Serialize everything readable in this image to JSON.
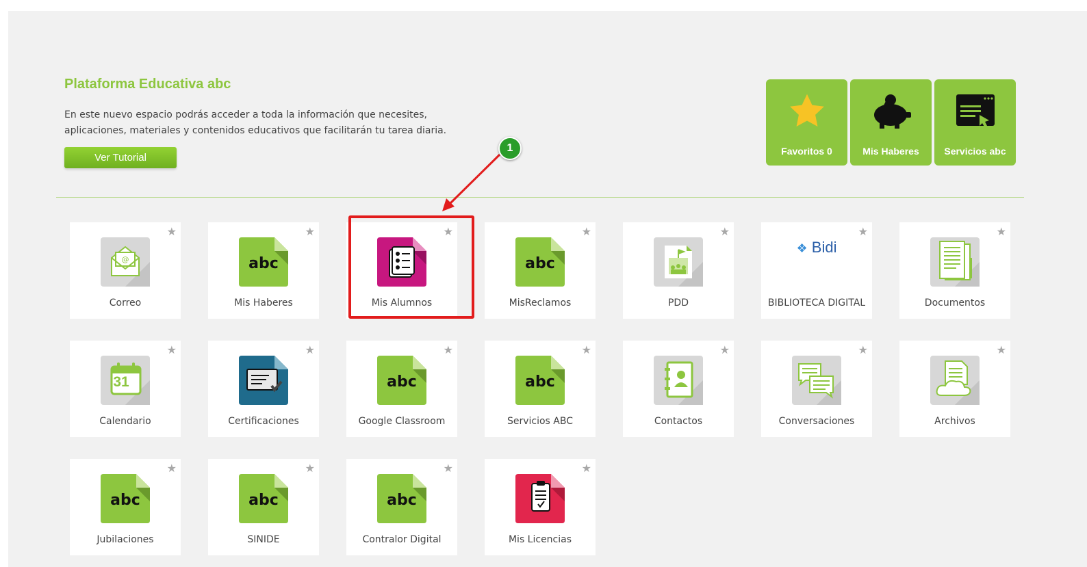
{
  "header": {
    "title": "Plataforma Educativa abc",
    "description_line1": "En este nuevo espacio podrás acceder a toda la información que necesites,",
    "description_line2": "aplicaciones, materiales y contenidos educativos que facilitarán tu tarea diaria.",
    "tutorial_button": "Ver Tutorial"
  },
  "quick_links": [
    {
      "label": "Favoritos 0",
      "icon": "star-icon"
    },
    {
      "label": "Mis Haberes",
      "icon": "piggy-bank-icon"
    },
    {
      "label": "Servicios abc",
      "icon": "services-window-icon"
    }
  ],
  "apps": [
    {
      "label": "Correo",
      "icon": "mail-icon"
    },
    {
      "label": "Mis Haberes",
      "icon": "abc-doc-icon"
    },
    {
      "label": "Mis Alumnos",
      "icon": "students-list-icon"
    },
    {
      "label": "MisReclamos",
      "icon": "abc-doc-icon"
    },
    {
      "label": "PDD",
      "icon": "school-photo-icon"
    },
    {
      "label": "BIBLIOTECA DIGITAL",
      "icon": "bidi-logo-icon",
      "logo_text": "Bidi"
    },
    {
      "label": "Documentos",
      "icon": "documents-icon"
    },
    {
      "label": "Calendario",
      "icon": "calendar-icon",
      "day": "31"
    },
    {
      "label": "Certificaciones",
      "icon": "certificate-icon"
    },
    {
      "label": "Google Classroom",
      "icon": "abc-doc-icon"
    },
    {
      "label": "Servicios ABC",
      "icon": "abc-doc-icon"
    },
    {
      "label": "Contactos",
      "icon": "contacts-book-icon"
    },
    {
      "label": "Conversaciones",
      "icon": "chat-bubbles-icon"
    },
    {
      "label": "Archivos",
      "icon": "cloud-file-icon"
    },
    {
      "label": "Jubilaciones",
      "icon": "abc-doc-icon"
    },
    {
      "label": "SINIDE",
      "icon": "abc-doc-icon"
    },
    {
      "label": "Contralor Digital",
      "icon": "abc-doc-icon"
    },
    {
      "label": "Mis Licencias",
      "icon": "clipboard-icon"
    }
  ],
  "annotation": {
    "step_number": "1"
  },
  "colors": {
    "brand_green": "#8dc63f",
    "highlight_red": "#e21c1c",
    "badge_green": "#2a9d2a",
    "alumnos_pink": "#c7177f",
    "licencias_red": "#e2264d"
  }
}
